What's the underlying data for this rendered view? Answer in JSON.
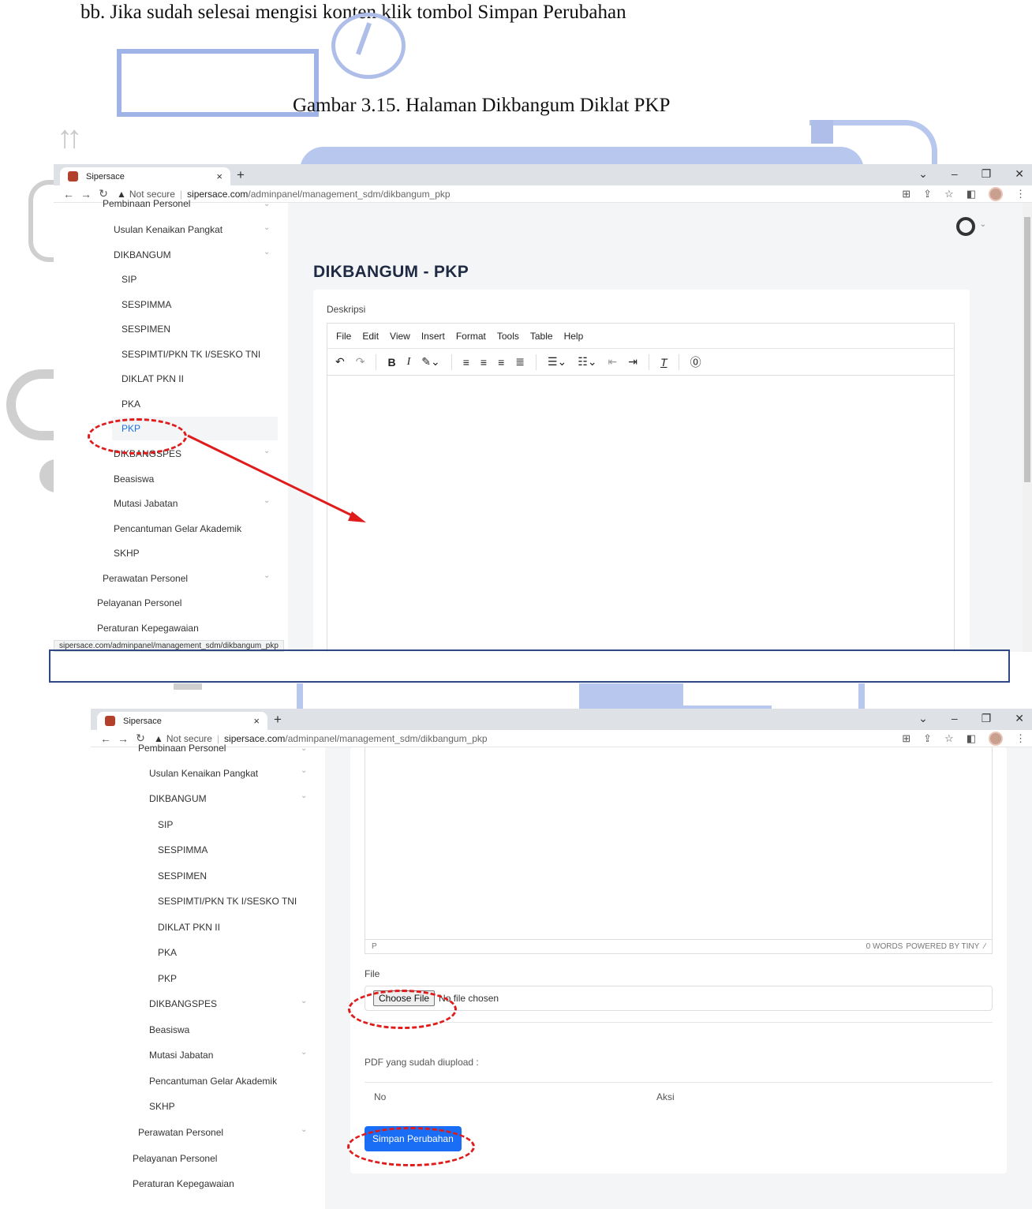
{
  "document": {
    "instruction": "bb. Jika sudah selesai mengisi konten klik tombol Simpan Perubahan",
    "caption": "Gambar 3.15. Halaman Dikbangum Diklat PKP"
  },
  "browser": {
    "tab_title": "Sipersace",
    "new_tab": "+",
    "close": "×",
    "win_controls": [
      "⌄",
      "–",
      "❐",
      "✕"
    ],
    "not_secure": "Not secure",
    "url_host": "sipersace.com",
    "url_path": "/adminpanel/management_sdm/dikbangum_pkp",
    "status_url": "sipersace.com/adminpanel/management_sdm/dikbangum_pkp"
  },
  "sidebar": {
    "items": [
      {
        "label": "Pembinaan Personel"
      },
      {
        "label": "Usulan Kenaikan Pangkat"
      },
      {
        "label": "DIKBANGUM"
      },
      {
        "label": "SIP"
      },
      {
        "label": "SESPIMMA"
      },
      {
        "label": "SESPIMEN"
      },
      {
        "label": "SESPIMTI/PKN TK I/SESKO TNI"
      },
      {
        "label": "DIKLAT PKN II"
      },
      {
        "label": "PKA"
      },
      {
        "label": "PKP"
      },
      {
        "label": "DIKBANGSPES"
      },
      {
        "label": "Beasiswa"
      },
      {
        "label": "Mutasi Jabatan"
      },
      {
        "label": "Pencantuman Gelar Akademik"
      },
      {
        "label": "SKHP"
      },
      {
        "label": "Perawatan Personel"
      },
      {
        "label": "Pelayanan Personel"
      },
      {
        "label": "Peraturan Kepegawaian"
      }
    ]
  },
  "main": {
    "title": "DIKBANGUM - PKP",
    "description_label": "Deskripsi",
    "editor_menu": [
      "File",
      "Edit",
      "View",
      "Insert",
      "Format",
      "Tools",
      "Table",
      "Help"
    ],
    "editor_path": "P",
    "word_count": "0 WORDS",
    "powered_by": "POWERED BY TINY",
    "file_label": "File",
    "choose_file": "Choose File",
    "no_file": "No file chosen",
    "pdf_label": "PDF yang sudah diupload :",
    "table_headers": [
      "No",
      "Aksi"
    ],
    "save_button": "Simpan Perubahan"
  }
}
